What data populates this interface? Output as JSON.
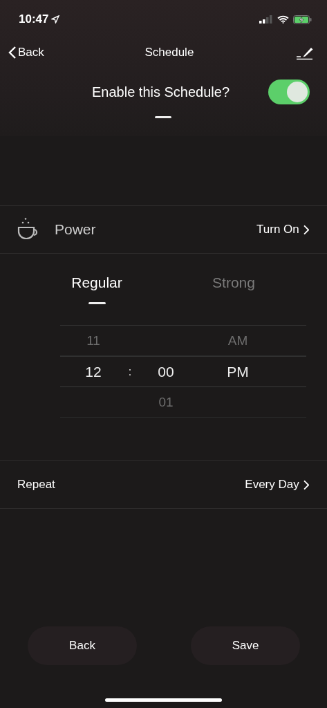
{
  "status_bar": {
    "time": "10:47",
    "charging": true
  },
  "nav": {
    "back": "Back",
    "title": "Schedule"
  },
  "enable": {
    "label": "Enable this Schedule?",
    "on": true
  },
  "power": {
    "label": "Power",
    "value": "Turn On"
  },
  "tabs": [
    {
      "label": "Regular",
      "selected": true
    },
    {
      "label": "Strong",
      "selected": false
    }
  ],
  "picker": {
    "separator": ":",
    "rows": [
      {
        "hour": "11",
        "period": "AM",
        "selected": false
      },
      {
        "hour": "12",
        "minute": "00",
        "period": "PM",
        "selected": true
      },
      {
        "minute": "01",
        "selected": false
      }
    ]
  },
  "repeat": {
    "label": "Repeat",
    "value": "Every Day"
  },
  "buttons": [
    "Back",
    "Save"
  ]
}
